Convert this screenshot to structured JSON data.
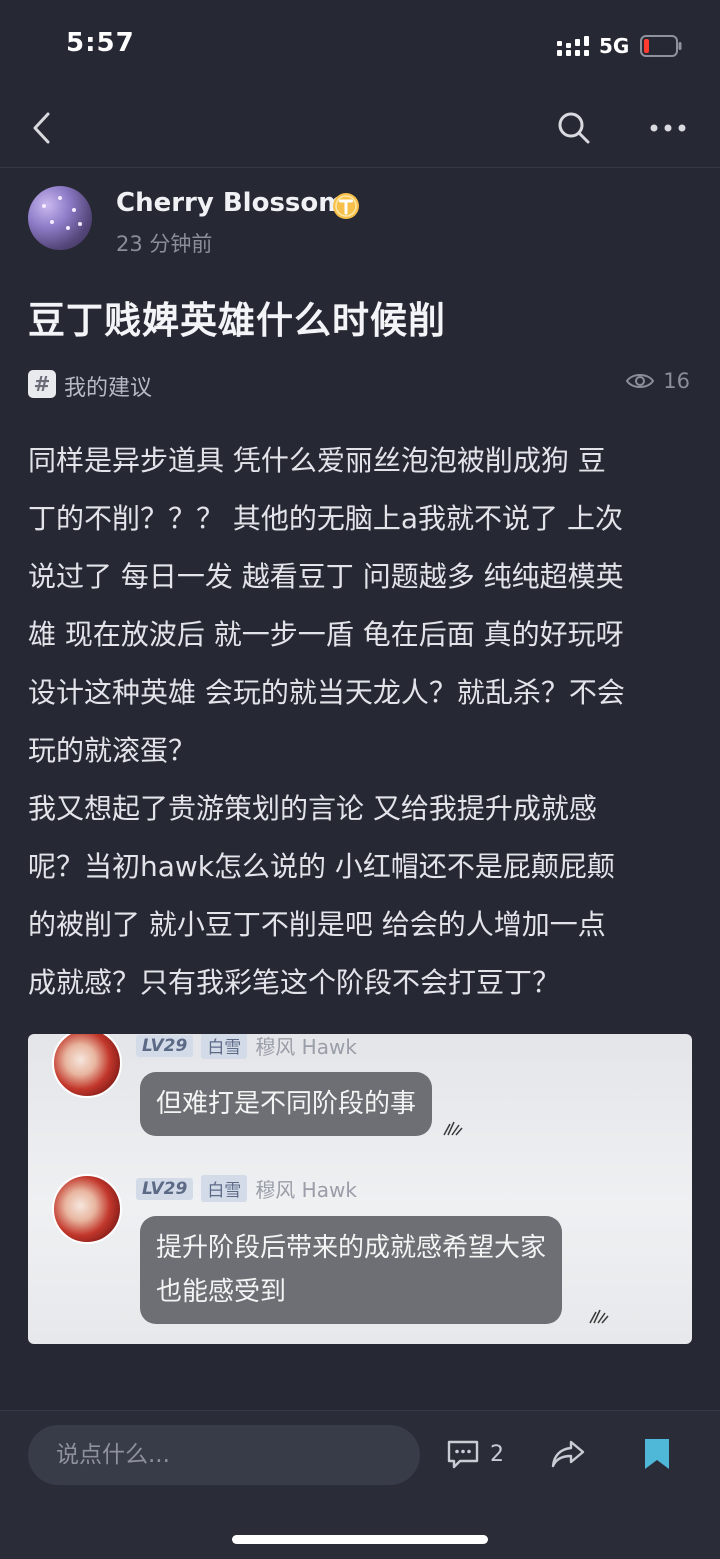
{
  "status_bar": {
    "time": "5:57",
    "network": "5G"
  },
  "nav": {
    "back_icon": "chevron-left-icon",
    "search_icon": "search-icon",
    "more_icon": "more-horizontal-icon"
  },
  "post": {
    "author": {
      "name": "Cherry Blossom",
      "badge_icon": "t-badge-icon",
      "time": "23 分钟前"
    },
    "title": "豆丁贱婢英雄什么时候削",
    "topic": {
      "icon": "#",
      "label": "我的建议"
    },
    "views": "16",
    "body_lines": [
      "同样是异步道具 凭什么爱丽丝泡泡被削成狗 豆",
      "丁的不削？？？ 其他的无脑上a我就不说了 上次",
      "说过了 每日一发 越看豆丁 问题越多 纯纯超模英",
      "雄 现在放波后 就一步一盾 龟在后面 真的好玩呀",
      "设计这种英雄 会玩的就当天龙人？就乱杀？不会",
      "玩的就滚蛋？",
      "我又想起了贵游策划的言论 又给我提升成就感",
      "呢？当初hawk怎么说的 小红帽还不是屁颠屁颠",
      "的被削了 就小豆丁不削是吧 给会的人增加一点",
      "成就感？只有我彩笔这个阶段不会打豆丁？"
    ],
    "image": {
      "messages": [
        {
          "level": "LV29",
          "title": "白雪",
          "sender": "穆风 Hawk",
          "text_lines": [
            "但难打是不同阶段的事"
          ]
        },
        {
          "level": "LV29",
          "title": "白雪",
          "sender": "穆风 Hawk",
          "text_lines": [
            "提升阶段后带来的成就感希望大家",
            "也能感受到"
          ]
        }
      ]
    }
  },
  "bottom_bar": {
    "comment_placeholder": "说点什么...",
    "comment_icon": "comment-icon",
    "comment_count": "2",
    "share_icon": "share-icon",
    "bookmark_icon": "bookmark-icon"
  },
  "colors": {
    "background": "#262833",
    "bookmark_accent": "#4fb8d9"
  }
}
